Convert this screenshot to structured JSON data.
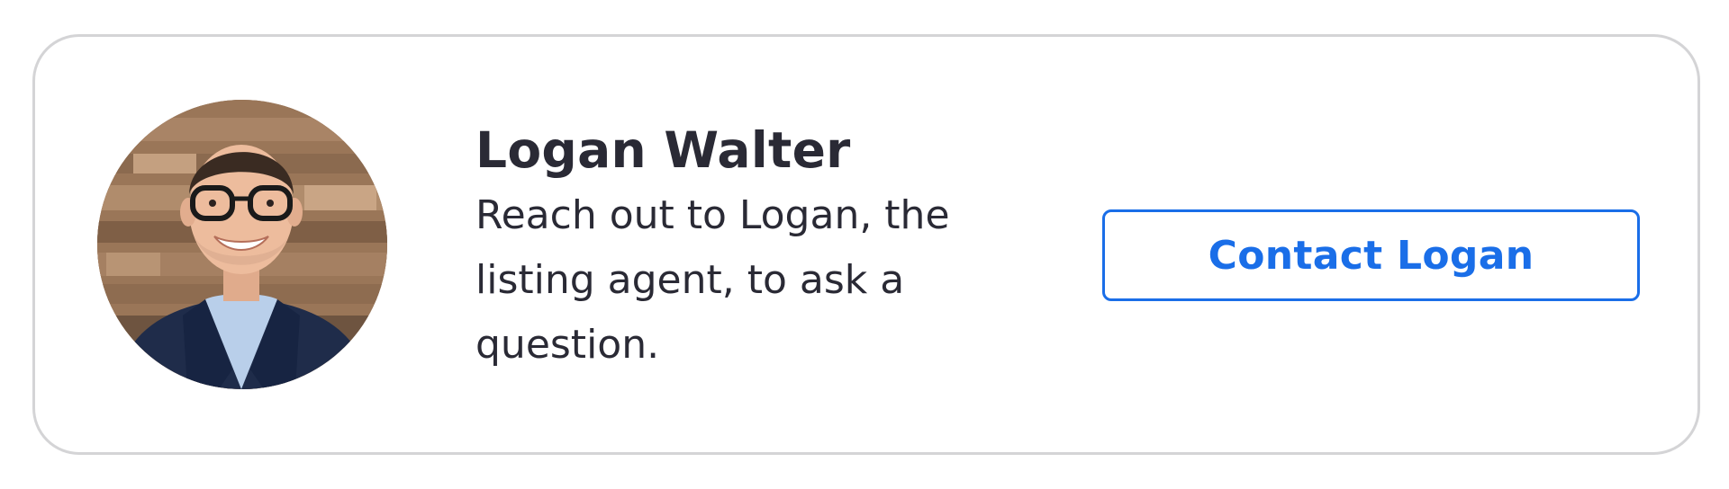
{
  "agent": {
    "name": "Logan Walter",
    "description": "Reach out to Logan, the listing agent, to ask a question.",
    "photo_icon": "agent-portrait"
  },
  "contact_button": {
    "label": "Contact Logan"
  },
  "colors": {
    "accent": "#1a6ee8",
    "text": "#2a2a35",
    "card_border": "#d4d4d6",
    "background": "#ffffff"
  }
}
